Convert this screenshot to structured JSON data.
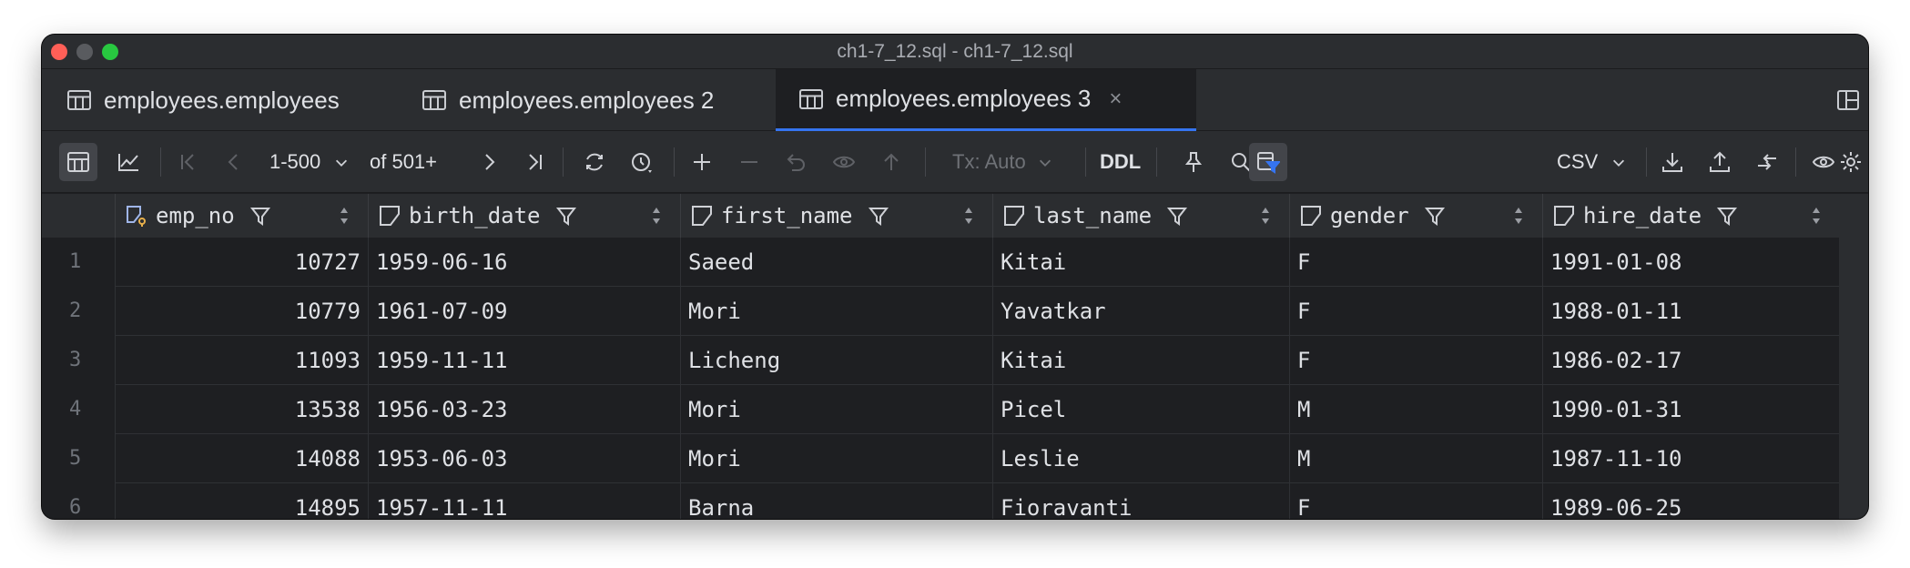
{
  "window": {
    "title": "ch1-7_12.sql - ch1-7_12.sql"
  },
  "tabs": [
    {
      "label": "employees.employees",
      "active": false
    },
    {
      "label": "employees.employees 2",
      "active": false
    },
    {
      "label": "employees.employees 3",
      "active": true,
      "close": "×"
    }
  ],
  "toolbar": {
    "range": "1-500",
    "of_total": "of 501+",
    "tx_mode": "Tx: Auto",
    "ddl": "DDL",
    "export_format": "CSV"
  },
  "columns": [
    "emp_no",
    "birth_date",
    "first_name",
    "last_name",
    "gender",
    "hire_date"
  ],
  "rows": [
    {
      "n": "1",
      "cells": [
        "10727",
        "1959-06-16",
        "Saeed",
        "Kitai",
        "F",
        "1991-01-08"
      ]
    },
    {
      "n": "2",
      "cells": [
        "10779",
        "1961-07-09",
        "Mori",
        "Yavatkar",
        "F",
        "1988-01-11"
      ]
    },
    {
      "n": "3",
      "cells": [
        "11093",
        "1959-11-11",
        "Licheng",
        "Kitai",
        "F",
        "1986-02-17"
      ]
    },
    {
      "n": "4",
      "cells": [
        "13538",
        "1956-03-23",
        "Mori",
        "Picel",
        "M",
        "1990-01-31"
      ]
    },
    {
      "n": "5",
      "cells": [
        "14088",
        "1953-06-03",
        "Mori",
        "Leslie",
        "M",
        "1987-11-10"
      ]
    },
    {
      "n": "6",
      "cells": [
        "14895",
        "1957-11-11",
        "Barna",
        "Fioravanti",
        "F",
        "1989-06-25"
      ]
    }
  ],
  "colors": {
    "accent": "#3574f0",
    "background": "#1e1f22",
    "panel": "#2b2d30"
  }
}
